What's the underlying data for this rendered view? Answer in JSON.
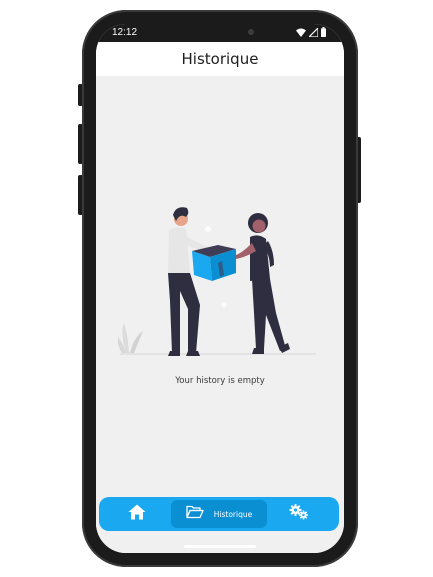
{
  "status_bar": {
    "time": "12:12",
    "icons": [
      "wifi-icon",
      "signal-icon",
      "battery-icon"
    ]
  },
  "header": {
    "title": "Historique"
  },
  "main": {
    "empty_message": "Your history is empty",
    "illustration": "two-people-exchanging-box"
  },
  "bottom_nav": {
    "items": [
      {
        "icon": "home-icon",
        "label": "",
        "active": false
      },
      {
        "icon": "folder-open-icon",
        "label": "Historique",
        "active": true
      },
      {
        "icon": "gears-icon",
        "label": "",
        "active": false
      }
    ]
  },
  "colors": {
    "accent": "#1aa9f0",
    "accent_active": "#0b8fd3",
    "background": "#f0f0f0",
    "phone_frame": "#1b1b1b"
  }
}
